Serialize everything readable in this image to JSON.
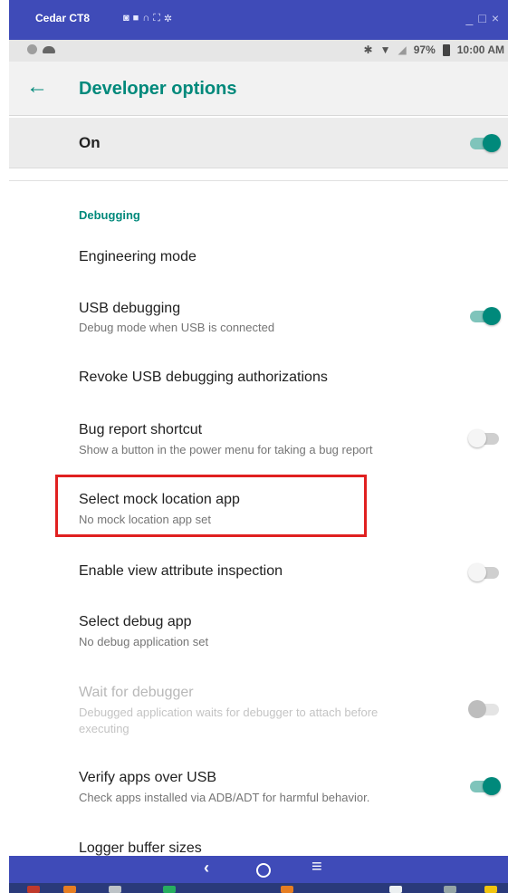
{
  "window": {
    "title": "Cedar CT8",
    "tool_icons": [
      "camera-icon",
      "video-icon",
      "headset-icon",
      "fullscreen-icon",
      "settings-icon"
    ],
    "controls": [
      "minimize-icon",
      "maximize-icon",
      "close-icon"
    ]
  },
  "status_bar": {
    "battery_percent": "97%",
    "time": "10:00 AM",
    "icons": [
      "circle-icon",
      "cloud-icon",
      "bluetooth-icon",
      "wifi-icon",
      "no-signal-icon",
      "battery-icon"
    ]
  },
  "toolbar": {
    "title": "Developer options"
  },
  "master_switch": {
    "label": "On",
    "checked": true
  },
  "debugging": {
    "category": "Debugging",
    "items": [
      {
        "title": "Engineering mode"
      },
      {
        "title": "USB debugging",
        "summary": "Debug mode when USB is connected",
        "switch": "on"
      },
      {
        "title": "Revoke USB debugging authorizations"
      },
      {
        "title": "Bug report shortcut",
        "summary": "Show a button in the power menu for taking a bug report",
        "switch": "off"
      },
      {
        "title": "Select mock location app",
        "summary": "No mock location app set",
        "highlighted": true
      },
      {
        "title": "Enable view attribute inspection",
        "switch": "off"
      },
      {
        "title": "Select debug app",
        "summary": "No debug application set"
      },
      {
        "title": "Wait for debugger",
        "summary_line1": "Debugged application waits for debugger to attach before",
        "summary_line2": "executing",
        "switch": "off",
        "disabled": true
      },
      {
        "title": "Verify apps over USB",
        "summary": "Check apps installed via ADB/ADT for harmful behavior.",
        "switch": "on"
      },
      {
        "title": "Logger buffer sizes"
      }
    ]
  },
  "nav_bar": {
    "back": "‹",
    "menu": "≡"
  },
  "colors": {
    "accent": "#00897b",
    "window_bar": "#3f4bb8",
    "highlight": "#e02020"
  }
}
